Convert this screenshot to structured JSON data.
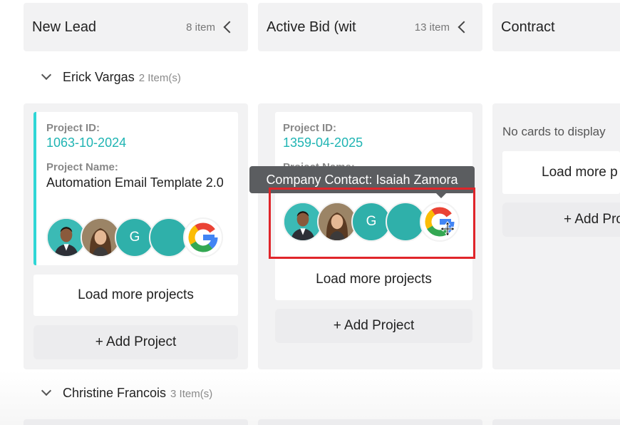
{
  "columns": [
    {
      "title": "New Lead",
      "count": "8 item"
    },
    {
      "title": "Active Bid (wit",
      "count": "13 item"
    },
    {
      "title": "Contract",
      "count": ""
    }
  ],
  "groups": [
    {
      "name": "Erick Vargas",
      "count": "2 Item(s)"
    },
    {
      "name": "Christine Francois",
      "count": "3 Item(s)"
    }
  ],
  "cards": [
    {
      "project_id_label": "Project ID:",
      "project_id": "1063-10-2024",
      "project_name_label": "Project Name:",
      "project_name": "Automation Email Template 2.0"
    },
    {
      "project_id_label": "Project ID:",
      "project_id": "1359-04-2025",
      "project_name_label": "Project Name:"
    }
  ],
  "avatar_letter": "G",
  "load_more_label": "Load more projects",
  "add_project_label": "+ Add Project",
  "no_cards_text": "No cards to display",
  "contract_load_more_partial": "Load more p",
  "contract_add_partial": "+ Add Pro",
  "tooltip_text": "Company Contact: Isaiah Zamora",
  "colors": {
    "accent": "#1fb4b3",
    "avatar_teal": "#2fb0aa",
    "highlight": "#e0252a"
  }
}
